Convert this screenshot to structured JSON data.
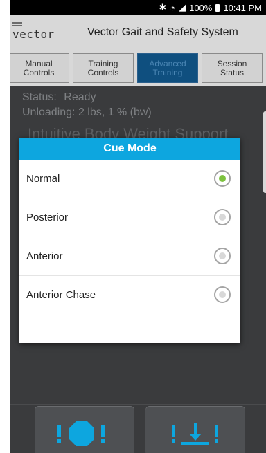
{
  "status_bar": {
    "icons": [
      "bluetooth-icon",
      "wifi-icon",
      "signal-icon",
      "battery-icon"
    ],
    "battery": "100%",
    "time": "10:41 PM"
  },
  "app": {
    "logo_text": "vector",
    "title": "Vector Gait and Safety System"
  },
  "tabs": [
    {
      "line1": "Manual",
      "line2": "Controls",
      "active": false
    },
    {
      "line1": "Training",
      "line2": "Controls",
      "active": false
    },
    {
      "line1": "Advanced",
      "line2": "Training",
      "active": true
    },
    {
      "line1": "Session",
      "line2": "Status",
      "active": false
    }
  ],
  "content": {
    "status_label": "Status:",
    "status_value": "Ready",
    "unloading": "Unloading: 2 lbs, 1 % (bw)",
    "heading": "Intuitive Body Weight Support"
  },
  "dialog": {
    "title": "Cue Mode",
    "options": [
      {
        "label": "Normal",
        "selected": true
      },
      {
        "label": "Posterior",
        "selected": false
      },
      {
        "label": "Anterior",
        "selected": false
      },
      {
        "label": "Anterior Chase",
        "selected": false
      }
    ]
  },
  "bottom_buttons": [
    {
      "name": "emergency-stop-button",
      "icon": "stop-icon"
    },
    {
      "name": "unload-button",
      "icon": "unload-arrow-icon"
    }
  ],
  "colors": {
    "accent": "#0da6df",
    "active_tab": "#0f4f7f",
    "selected_radio": "#7dc23f",
    "button_glyph": "#0da6df"
  }
}
